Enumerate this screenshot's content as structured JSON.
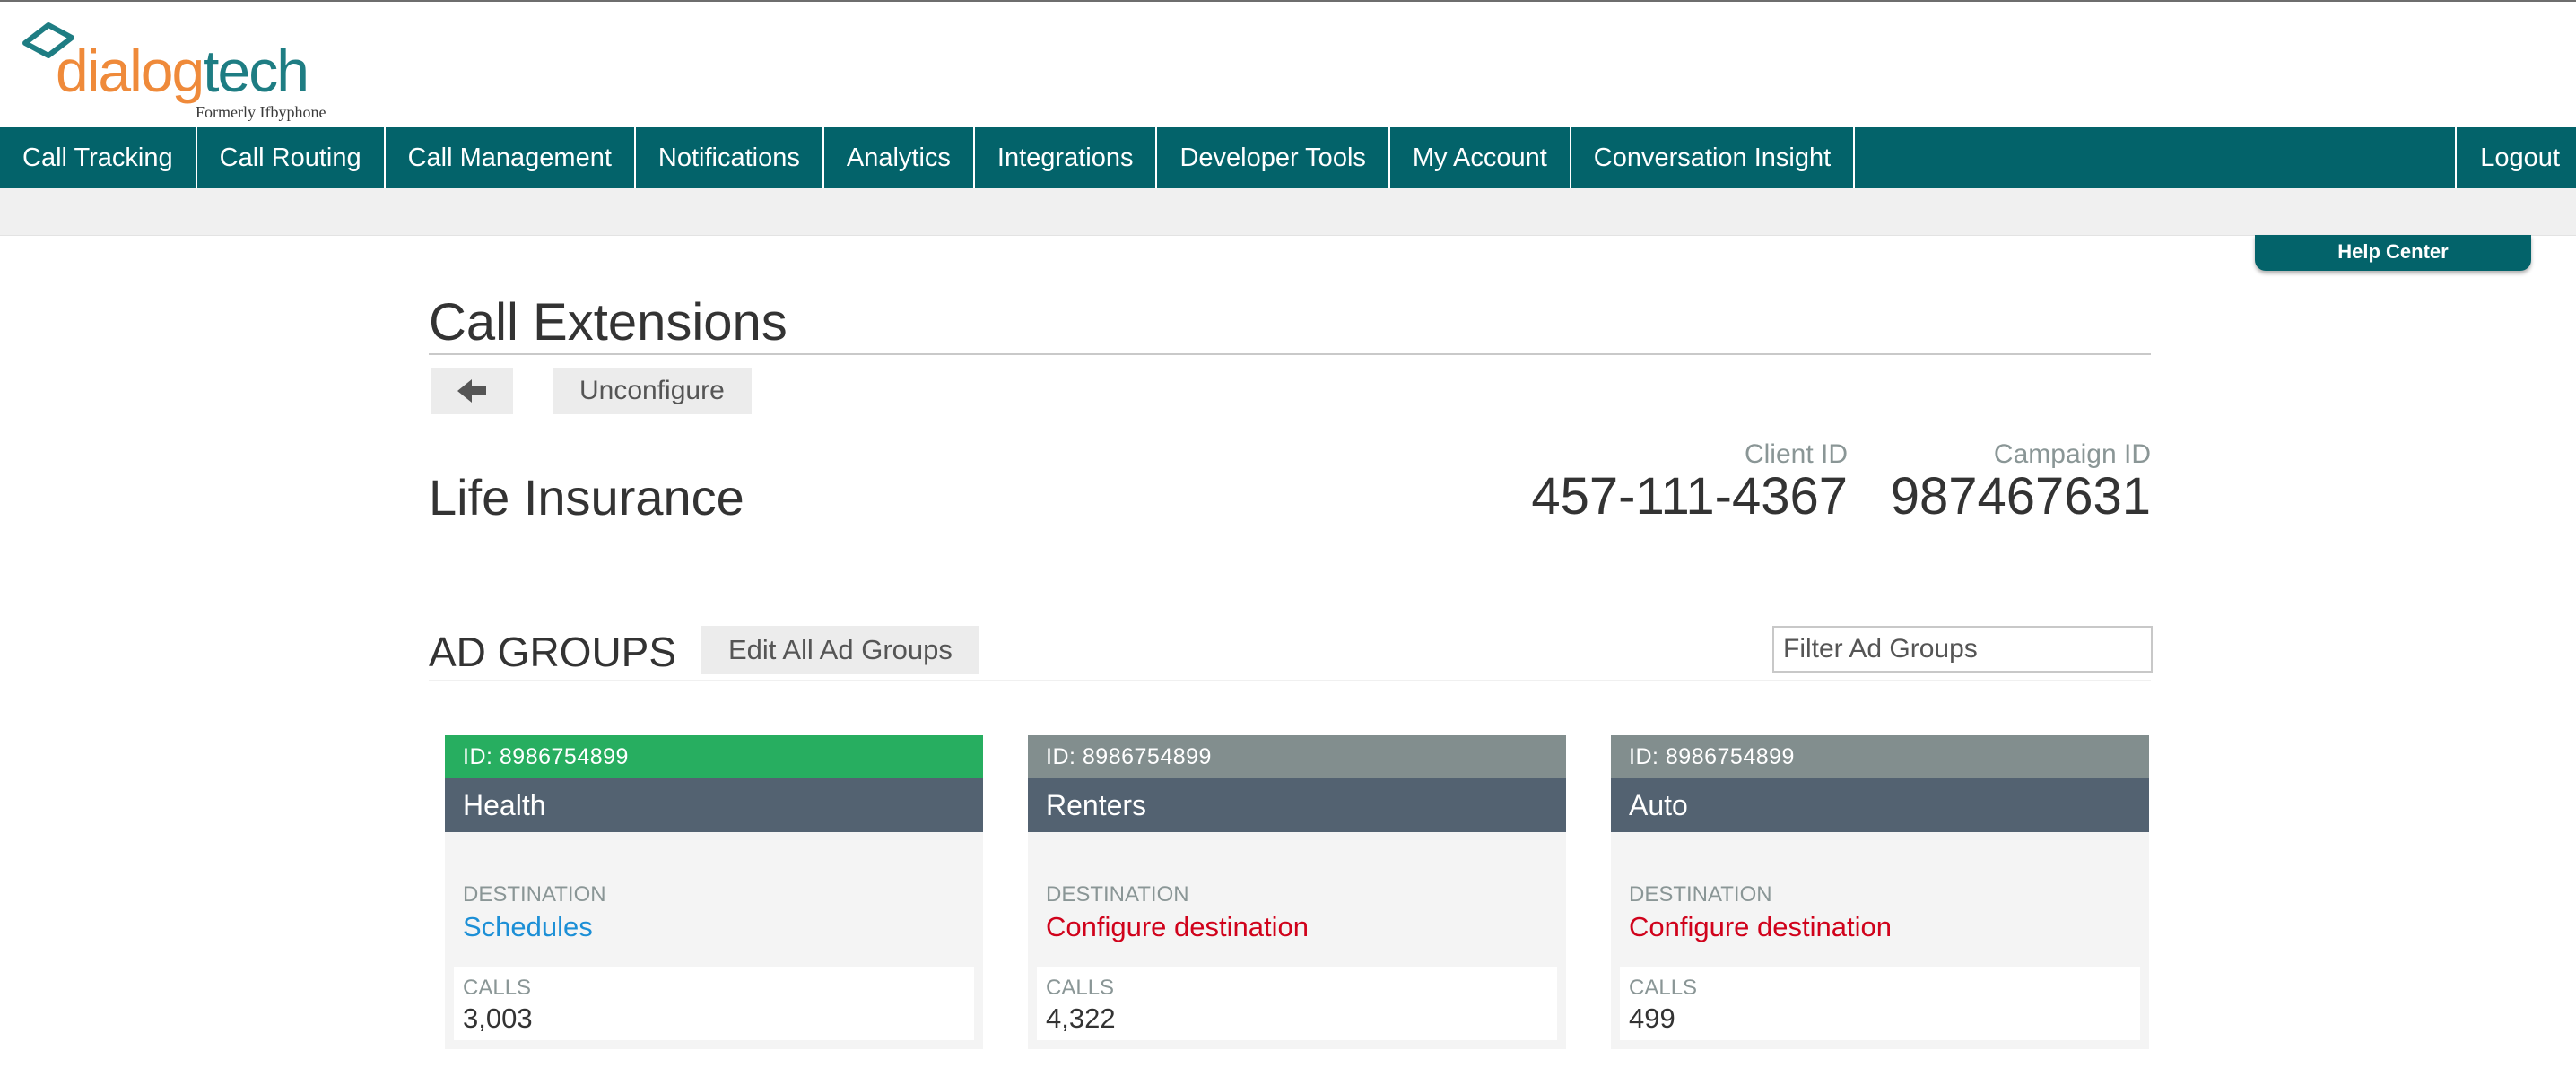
{
  "brand": {
    "name_part1": "dialog",
    "name_part2": "tech",
    "tagline": "Formerly Ifbyphone"
  },
  "nav": {
    "items": [
      {
        "label": "Call Tracking"
      },
      {
        "label": "Call Routing"
      },
      {
        "label": "Call Management"
      },
      {
        "label": "Notifications"
      },
      {
        "label": "Analytics"
      },
      {
        "label": "Integrations"
      },
      {
        "label": "Developer Tools"
      },
      {
        "label": "My Account"
      },
      {
        "label": "Conversation Insight"
      }
    ],
    "logout": "Logout",
    "color": "#03636a"
  },
  "help_center": "Help Center",
  "page": {
    "title": "Call Extensions",
    "back_icon": "arrow-left-icon",
    "unconfigure": "Unconfigure"
  },
  "campaign": {
    "name": "Life Insurance",
    "client_id_label": "Client ID",
    "client_id": "457-111-4367",
    "campaign_id_label": "Campaign ID",
    "campaign_id": "987467631"
  },
  "ad_groups": {
    "title": "AD GROUPS",
    "edit_all": "Edit All Ad Groups",
    "filter_placeholder": "Filter Ad Groups",
    "cards": [
      {
        "id": "ID: 8986754899",
        "name": "Health",
        "dest_label": "DESTINATION",
        "dest": "Schedules",
        "calls_label": "CALLS",
        "calls": "3,003",
        "status_color": "#27ae60"
      },
      {
        "id": "ID: 8986754899",
        "name": "Renters",
        "dest_label": "DESTINATION",
        "dest": "Configure destination",
        "calls_label": "CALLS",
        "calls": "4,322",
        "status_color": "#828e8e"
      },
      {
        "id": "ID: 8986754899",
        "name": "Auto",
        "dest_label": "DESTINATION",
        "dest": "Configure destination",
        "calls_label": "CALLS",
        "calls": "499",
        "status_color": "#828e8e"
      }
    ]
  }
}
